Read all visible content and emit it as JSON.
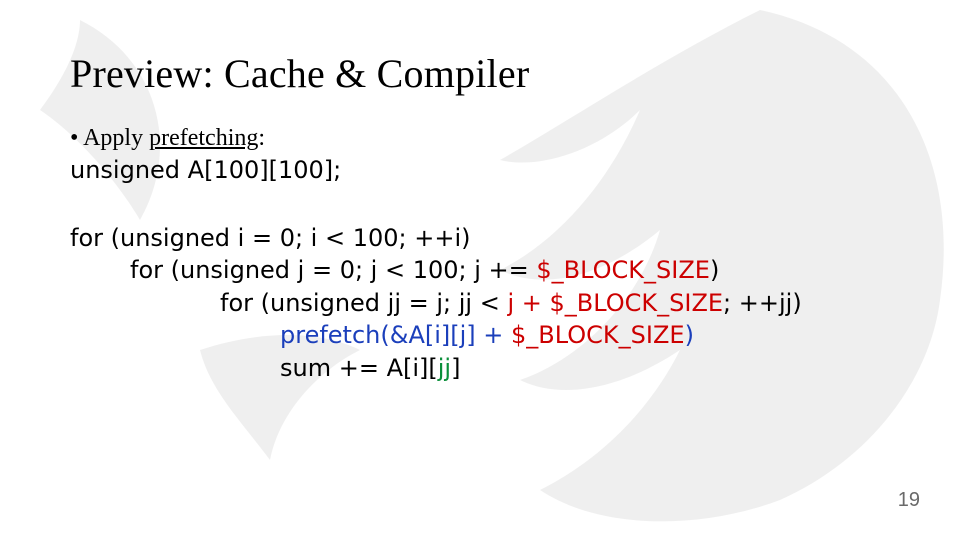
{
  "slide": {
    "title": "Preview: Cache & Compiler",
    "bullet_prefix": "• Apply ",
    "bullet_key_term": "prefetching",
    "bullet_suffix": ":",
    "declaration": "unsigned A[100][100];",
    "code": {
      "l1a": "for (unsigned i = 0; i < 100; ++i)",
      "l2a": "for (unsigned j = 0; j < 100; j += ",
      "l2b": "$_BLOCK_SIZE",
      "l2c": ")",
      "l3a": "for (unsigned jj = j; jj < ",
      "l3b": "j + $_BLOCK_SIZE",
      "l3c": "; ++jj)",
      "l4a_a": "prefetch(&A[i][j] + ",
      "l4a_b": "$_BLOCK_SIZE",
      "l4a_c": ")",
      "l4b_a": "sum += A[i][",
      "l4b_b": "jj",
      "l4b_c": "]"
    },
    "page_number": "19"
  }
}
